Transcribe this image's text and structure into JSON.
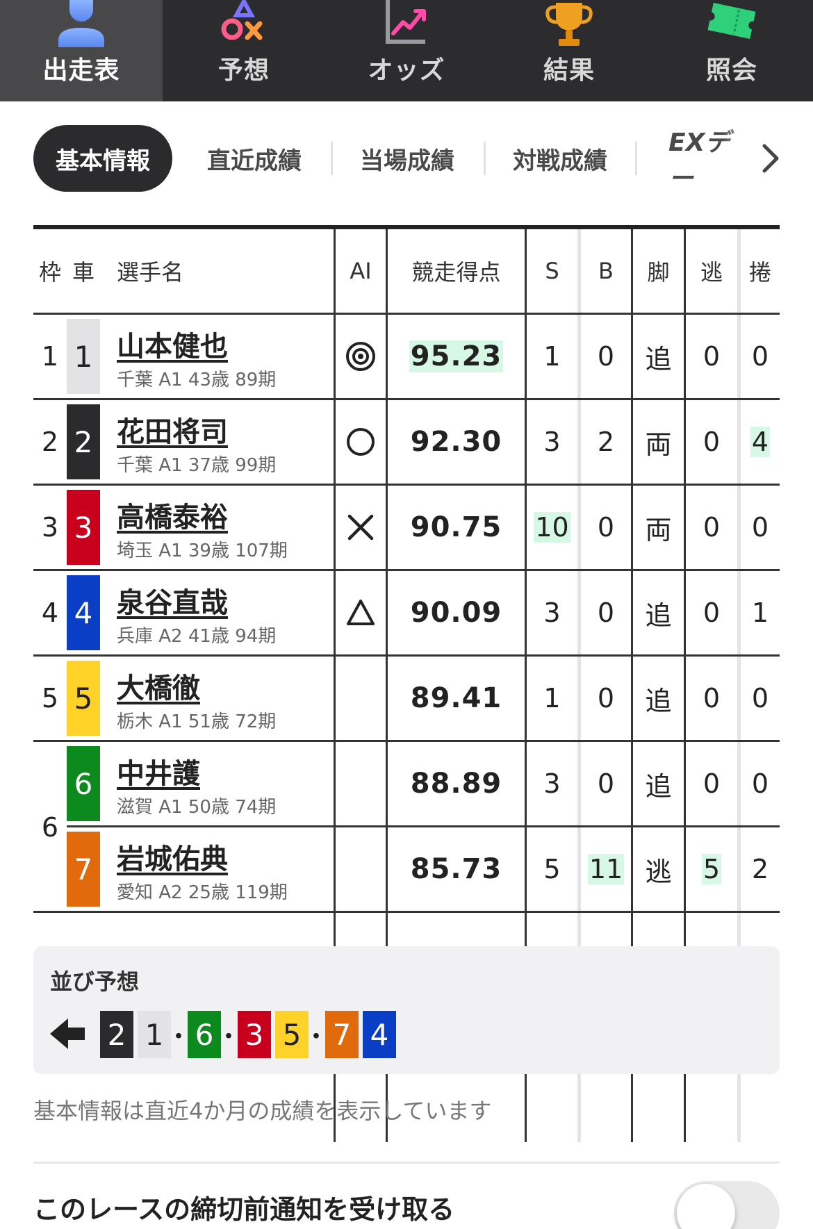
{
  "nav": {
    "items": [
      {
        "label": "出走表",
        "icon": "person-icon",
        "active": true
      },
      {
        "label": "予想",
        "icon": "symbols-icon",
        "active": false
      },
      {
        "label": "オッズ",
        "icon": "chart-trend-icon",
        "active": false
      },
      {
        "label": "結果",
        "icon": "trophy-icon",
        "active": false
      },
      {
        "label": "照会",
        "icon": "ticket-icon",
        "active": false
      }
    ]
  },
  "subtabs": {
    "active": "基本情報",
    "items": [
      "直近成績",
      "当場成績",
      "対戦成績"
    ],
    "more": "EXデー"
  },
  "table": {
    "headers": {
      "waku": "枠",
      "car": "車",
      "name": "選手名",
      "ai": "AI",
      "score": "競走得点",
      "s": "S",
      "b": "B",
      "kyaku": "脚",
      "nige": "逃",
      "makuri": "捲"
    },
    "rows": [
      {
        "waku": "1",
        "car": "1",
        "name": "山本健也",
        "info": "千葉 A1 43歳 89期",
        "ai": "double-circle",
        "score": "95.23",
        "s": "1",
        "b": "0",
        "kyaku": "追",
        "nige": "0",
        "makuri": "0"
      },
      {
        "waku": "2",
        "car": "2",
        "name": "花田将司",
        "info": "千葉 A1 37歳 99期",
        "ai": "circle",
        "score": "92.30",
        "s": "3",
        "b": "2",
        "kyaku": "両",
        "nige": "0",
        "makuri": "4"
      },
      {
        "waku": "3",
        "car": "3",
        "name": "高橋泰裕",
        "info": "埼玉 A1 39歳 107期",
        "ai": "cross",
        "score": "90.75",
        "s": "10",
        "b": "0",
        "kyaku": "両",
        "nige": "0",
        "makuri": "0"
      },
      {
        "waku": "4",
        "car": "4",
        "name": "泉谷直哉",
        "info": "兵庫 A2 41歳 94期",
        "ai": "triangle",
        "score": "90.09",
        "s": "3",
        "b": "0",
        "kyaku": "追",
        "nige": "0",
        "makuri": "1"
      },
      {
        "waku": "5",
        "car": "5",
        "name": "大橋徹",
        "info": "栃木 A1 51歳 72期",
        "ai": "",
        "score": "89.41",
        "s": "1",
        "b": "0",
        "kyaku": "追",
        "nige": "0",
        "makuri": "0"
      },
      {
        "waku": "6",
        "car": "6",
        "name": "中井護",
        "info": "滋賀 A1 50歳 74期",
        "ai": "",
        "score": "88.89",
        "s": "3",
        "b": "0",
        "kyaku": "追",
        "nige": "0",
        "makuri": "0"
      },
      {
        "waku": "",
        "car": "7",
        "name": "岩城佑典",
        "info": "愛知 A2 25歳 119期",
        "ai": "",
        "score": "85.73",
        "s": "5",
        "b": "11",
        "kyaku": "逃",
        "nige": "5",
        "makuri": "2"
      }
    ]
  },
  "colors": {
    "car1": "#e3e3e6",
    "car2": "#2b2b2e",
    "car3": "#c8001e",
    "car4": "#0a3ec4",
    "car5": "#ffd22a",
    "car6": "#0c8a1e",
    "car7": "#e06a0c",
    "highlight": "#d8f8e6"
  },
  "prediction": {
    "title": "並び予想",
    "sequence": [
      "2",
      "1",
      "・",
      "6",
      "・",
      "3",
      "5",
      "・",
      "7",
      "4"
    ]
  },
  "note": "基本情報は直近4か月の成績を表示しています",
  "notify": {
    "label": "このレースの締切前通知を受け取る",
    "enabled": false
  }
}
